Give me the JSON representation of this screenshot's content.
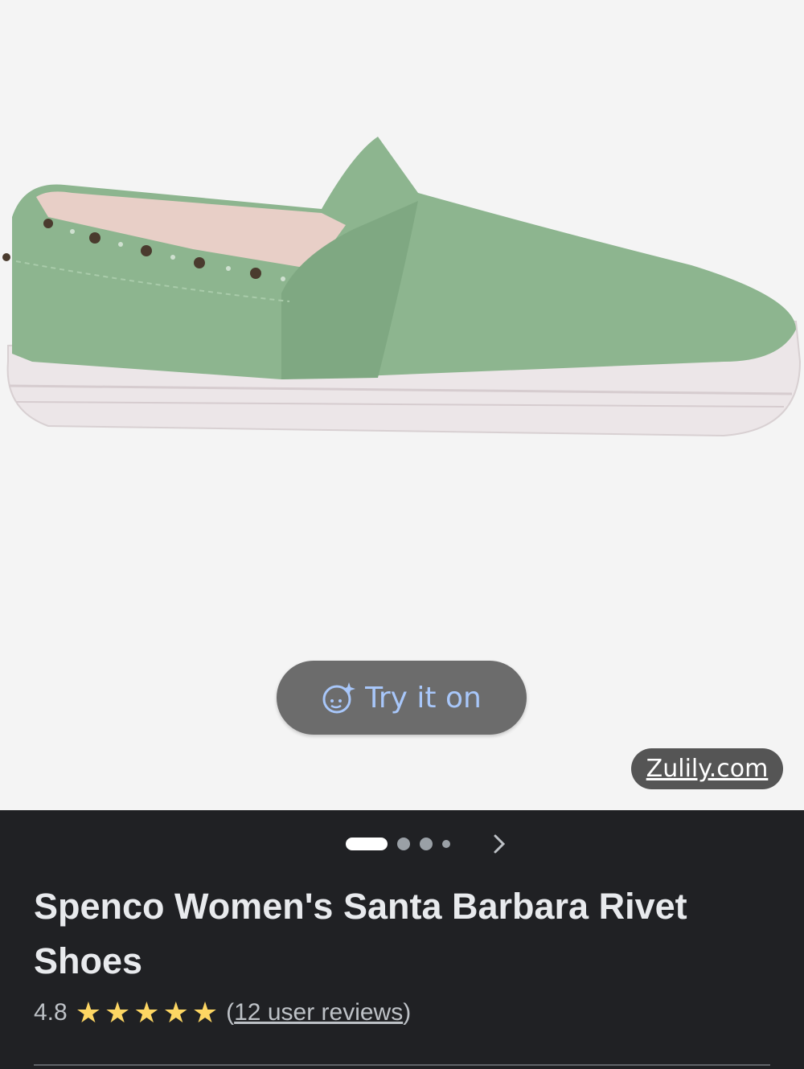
{
  "product": {
    "title": "Spenco Women's Santa Barbara Rivet Shoes",
    "rating": "4.8",
    "stars_filled": 5,
    "stars_total": 5,
    "reviews_open": "(",
    "reviews_text": "12 user reviews",
    "reviews_close": ")"
  },
  "try_on": {
    "label": "Try it on",
    "icon": "face-sparkle-icon"
  },
  "source": {
    "label": "Zulily.com"
  },
  "carousel": {
    "dot_count": 4,
    "active_index": 0,
    "next_icon": "chevron-right-icon"
  },
  "colors": {
    "panel_bg": "#202124",
    "star": "#fdd663",
    "try_on_text": "#a8c7fa",
    "shoe_upper": "#8db58f"
  }
}
